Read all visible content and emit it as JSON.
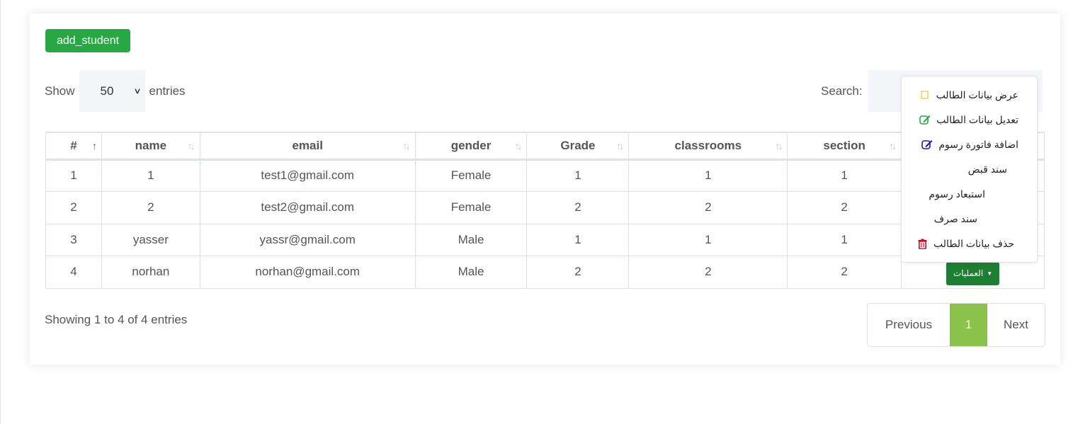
{
  "add_button": "add_student",
  "length": {
    "show": "Show",
    "value": "50",
    "entries": "entries"
  },
  "search": {
    "label": "Search:",
    "value": ""
  },
  "table": {
    "headers": [
      "#",
      "name",
      "email",
      "gender",
      "Grade",
      "classrooms",
      "section",
      ""
    ],
    "rows": [
      [
        "1",
        "1",
        "test1@gmail.com",
        "Female",
        "1",
        "1",
        "1"
      ],
      [
        "2",
        "2",
        "test2@gmail.com",
        "Female",
        "2",
        "2",
        "2"
      ],
      [
        "3",
        "yasser",
        "yassr@gmail.com",
        "Male",
        "1",
        "1",
        "1"
      ],
      [
        "4",
        "norhan",
        "norhan@gmail.com",
        "Male",
        "2",
        "2",
        "2"
      ]
    ],
    "ops_label": "العمليات"
  },
  "info": "Showing 1 to 4 of 4 entries",
  "pagination": {
    "prev": "Previous",
    "page": "1",
    "next": "Next"
  },
  "dropdown": {
    "items": [
      {
        "label": "عرض بيانات الطالب",
        "icon": "view-icon",
        "color": "#f5c518"
      },
      {
        "label": "تعديل بيانات الطالب",
        "icon": "edit-icon",
        "color": "#28a745"
      },
      {
        "label": "اضافة فاتورة رسوم",
        "icon": "edit-icon",
        "color": "#1a1ab8"
      },
      {
        "label": "سند قبض",
        "icon": "",
        "color": ""
      },
      {
        "label": "استبعاد رسوم",
        "icon": "",
        "color": ""
      },
      {
        "label": "سند صرف",
        "icon": "",
        "color": ""
      },
      {
        "label": "حذف بيانات الطالب",
        "icon": "trash-icon",
        "color": "#e3001b"
      }
    ]
  },
  "colors": {
    "accent": "#28a745",
    "page_active": "#8bc34a",
    "ops": "#1e7e34"
  }
}
